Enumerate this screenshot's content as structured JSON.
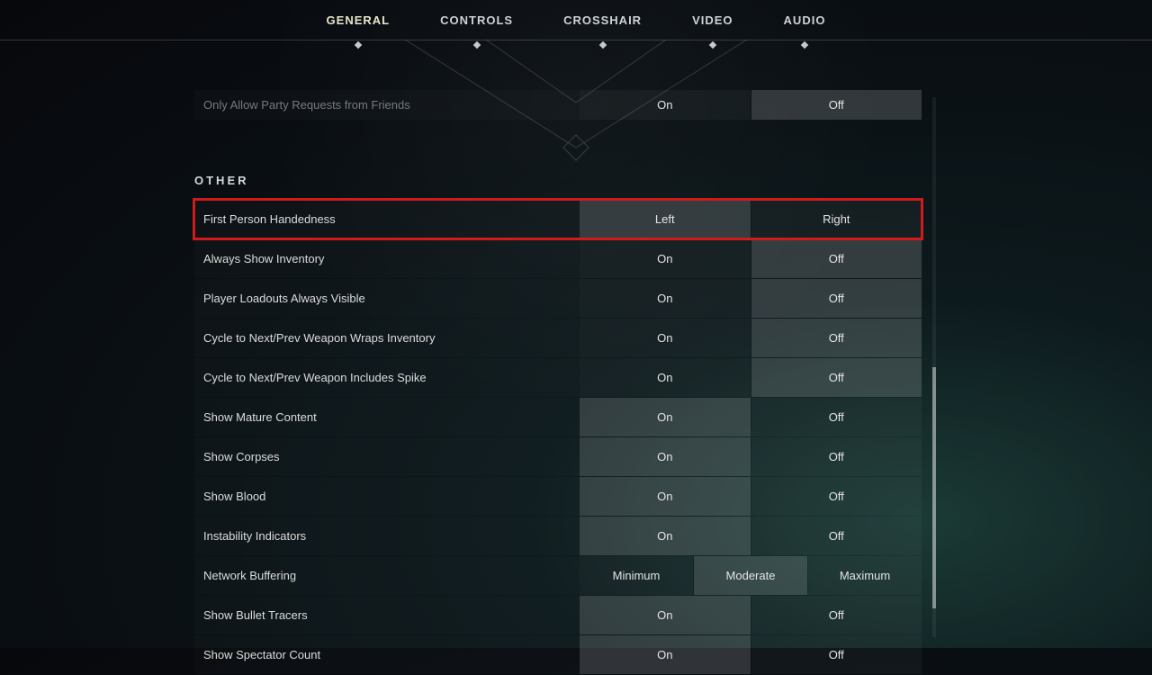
{
  "nav": {
    "items": [
      "GENERAL",
      "CONTROLS",
      "CROSSHAIR",
      "VIDEO",
      "AUDIO"
    ],
    "active_index": 0
  },
  "top_cut_row": {
    "label": "Only Allow Party Requests from Friends",
    "options": [
      "On",
      "Off"
    ],
    "selected_index": 1
  },
  "section_title": "OTHER",
  "rows": [
    {
      "label": "First Person Handedness",
      "options": [
        "Left",
        "Right"
      ],
      "selected_index": 0,
      "highlight": true
    },
    {
      "label": "Always Show Inventory",
      "options": [
        "On",
        "Off"
      ],
      "selected_index": 1
    },
    {
      "label": "Player Loadouts Always Visible",
      "options": [
        "On",
        "Off"
      ],
      "selected_index": 1
    },
    {
      "label": "Cycle to Next/Prev Weapon Wraps Inventory",
      "options": [
        "On",
        "Off"
      ],
      "selected_index": 1
    },
    {
      "label": "Cycle to Next/Prev Weapon Includes Spike",
      "options": [
        "On",
        "Off"
      ],
      "selected_index": 1
    },
    {
      "label": "Show Mature Content",
      "options": [
        "On",
        "Off"
      ],
      "selected_index": 0
    },
    {
      "label": "Show Corpses",
      "options": [
        "On",
        "Off"
      ],
      "selected_index": 0
    },
    {
      "label": "Show Blood",
      "options": [
        "On",
        "Off"
      ],
      "selected_index": 0
    },
    {
      "label": "Instability Indicators",
      "options": [
        "On",
        "Off"
      ],
      "selected_index": 0
    },
    {
      "label": "Network Buffering",
      "options": [
        "Minimum",
        "Moderate",
        "Maximum"
      ],
      "selected_index": 1
    },
    {
      "label": "Show Bullet Tracers",
      "options": [
        "On",
        "Off"
      ],
      "selected_index": 0
    },
    {
      "label": "Show Spectator Count",
      "options": [
        "On",
        "Off"
      ],
      "selected_index": 0
    }
  ]
}
